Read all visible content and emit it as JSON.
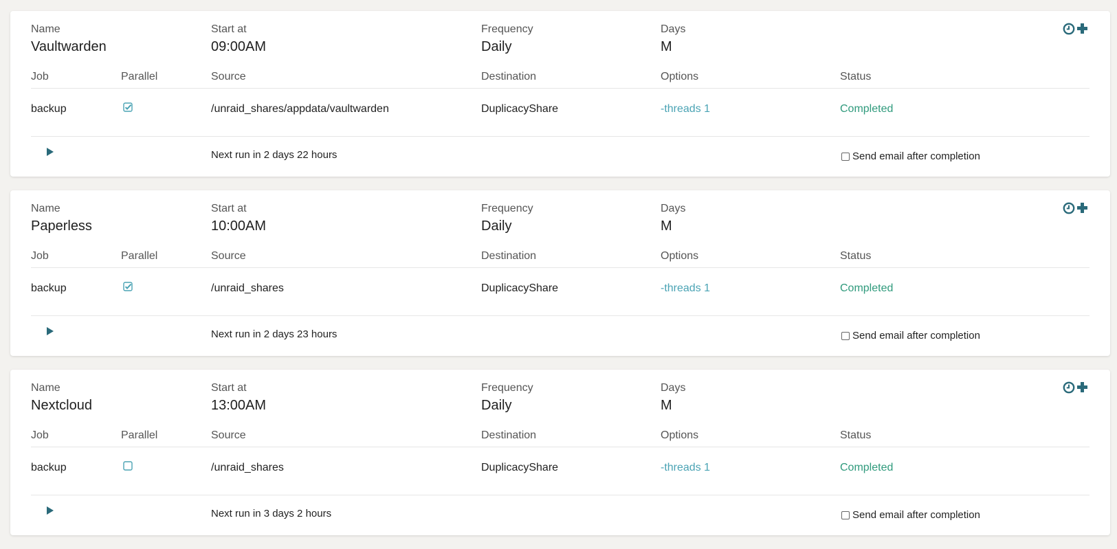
{
  "colors": {
    "background": "#f3f2ef",
    "accent": "#2a6a7a",
    "link": "#4aa3b4",
    "status_completed": "#2f9a7c"
  },
  "headers": {
    "name": "Name",
    "start_at": "Start at",
    "frequency": "Frequency",
    "days": "Days",
    "job": "Job",
    "parallel": "Parallel",
    "source": "Source",
    "destination": "Destination",
    "options": "Options",
    "status": "Status"
  },
  "icons": {
    "history": "clock-icon",
    "add": "plus-icon",
    "run": "play-icon",
    "parallel_checked": "checked-square-icon",
    "parallel_unchecked": "empty-square-icon"
  },
  "schedules": [
    {
      "name": "Vaultwarden",
      "start_at": "09:00AM",
      "frequency": "Daily",
      "days": "M",
      "job": {
        "type": "backup",
        "parallel": true,
        "source": "/unraid_shares/appdata/vaultwarden",
        "destination": "DuplicacyShare",
        "options": "-threads 1",
        "status": "Completed"
      },
      "next_run": "Next run in 2 days 22 hours",
      "email_label": "Send email after completion",
      "email_checked": false
    },
    {
      "name": "Paperless",
      "start_at": "10:00AM",
      "frequency": "Daily",
      "days": "M",
      "job": {
        "type": "backup",
        "parallel": true,
        "source": "/unraid_shares",
        "destination": "DuplicacyShare",
        "options": "-threads 1",
        "status": "Completed"
      },
      "next_run": "Next run in 2 days 23 hours",
      "email_label": "Send email after completion",
      "email_checked": false
    },
    {
      "name": "Nextcloud",
      "start_at": "13:00AM",
      "frequency": "Daily",
      "days": "M",
      "job": {
        "type": "backup",
        "parallel": false,
        "source": "/unraid_shares",
        "destination": "DuplicacyShare",
        "options": "-threads 1",
        "status": "Completed"
      },
      "next_run": "Next run in 3 days 2 hours",
      "email_label": "Send email after completion",
      "email_checked": false
    }
  ]
}
